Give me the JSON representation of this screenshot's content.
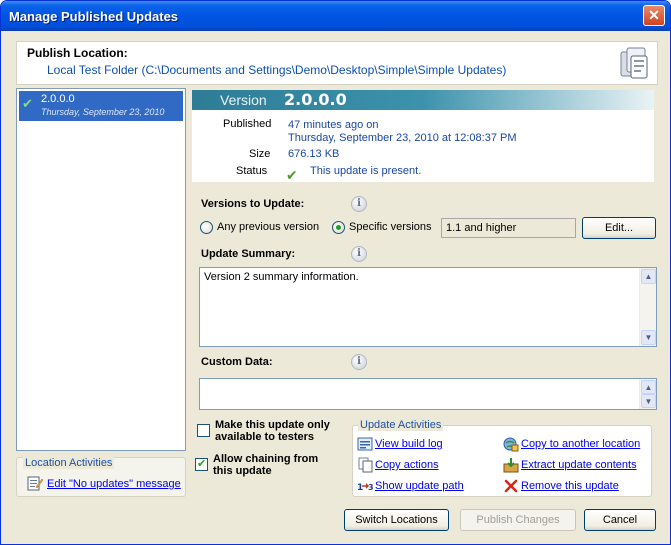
{
  "window": {
    "title": "Manage Published Updates",
    "close_glyph": "✕"
  },
  "header": {
    "label": "Publish Location:",
    "path": "Local Test Folder (C:\\Documents and Settings\\Demo\\Desktop\\Simple\\Simple Updates)",
    "icon": "update-store-icon"
  },
  "versions": [
    {
      "number": "2.0.0.0",
      "date": "Thursday, September 23, 2010",
      "icon": "check-icon",
      "selected": true
    }
  ],
  "location_activities": {
    "title": "Location Activities",
    "edit_link": "Edit \"No updates\" message",
    "icon": "edit-message-icon"
  },
  "details": {
    "version_label": "Version",
    "version_value": "2.0.0.0",
    "published_label": "Published",
    "published_relative": "47 minutes ago on",
    "published_date": "Thursday, September 23, 2010 at 12:08:37 PM",
    "size_label": "Size",
    "size_value": "676.13 KB",
    "status_label": "Status",
    "status_value": "This update is present.",
    "status_icon": "check-icon"
  },
  "versions_to_update": {
    "title": "Versions to Update:",
    "any_label": "Any previous version",
    "specific_label": "Specific versions",
    "selected": "specific",
    "range_value": "1.1 and higher",
    "edit_button": "Edit..."
  },
  "summary": {
    "title": "Update Summary:",
    "text": "Version 2 summary information."
  },
  "custom_data": {
    "title": "Custom Data:",
    "text": ""
  },
  "options": {
    "testers_only_line1": "Make this update only",
    "testers_only_line2": "available to testers",
    "testers_only_checked": false,
    "chaining_line1": "Allow chaining from",
    "chaining_line2": "this update",
    "chaining_checked": true
  },
  "update_activities": {
    "title": "Update Activities",
    "items": [
      {
        "label": "View build log",
        "icon": "build-log-icon"
      },
      {
        "label": "Copy actions",
        "icon": "copy-icon"
      },
      {
        "label": "Show update path",
        "icon": "update-path-icon"
      },
      {
        "label": "Copy to another location",
        "icon": "copy-location-icon"
      },
      {
        "label": "Extract update contents",
        "icon": "extract-icon"
      },
      {
        "label": "Remove this update",
        "icon": "remove-icon"
      }
    ]
  },
  "footer": {
    "switch_locations": "Switch Locations",
    "publish_changes": "Publish Changes",
    "cancel": "Cancel"
  },
  "colors": {
    "titlebar": "#0054E3",
    "selection": "#316AC5",
    "link": "#0000EE",
    "banner": "#2E7C96"
  }
}
